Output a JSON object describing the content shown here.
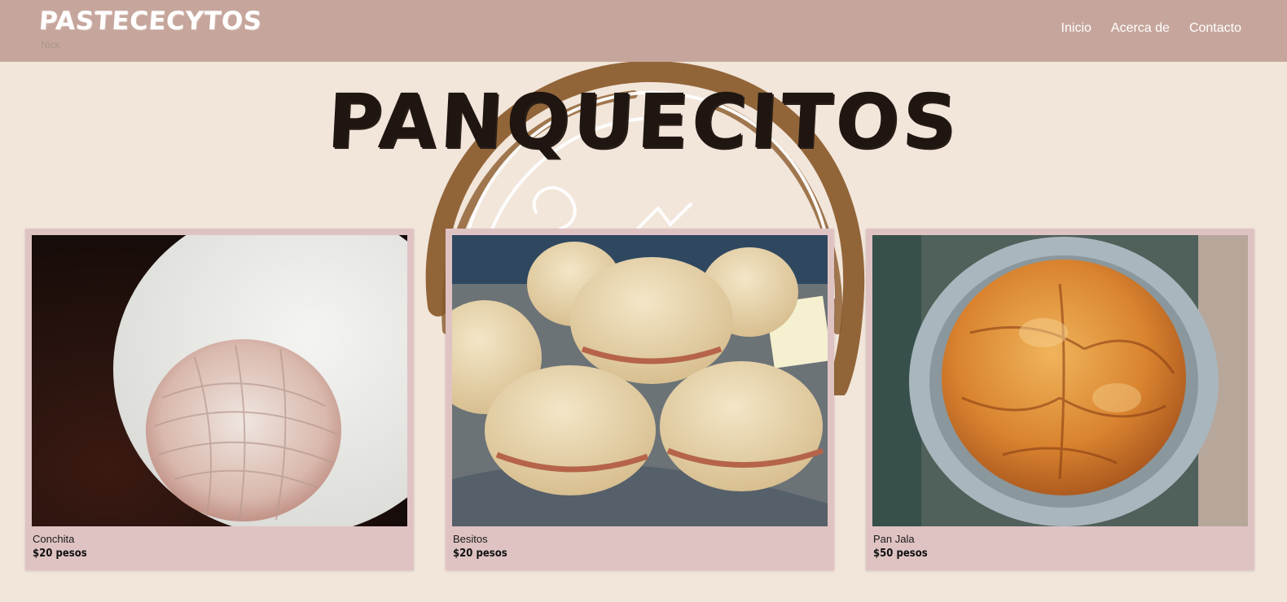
{
  "header": {
    "brand": "PASTECECYTOS",
    "brand_sub": "Nick",
    "nav": [
      {
        "label": "Inicio"
      },
      {
        "label": "Acerca de"
      },
      {
        "label": "Contacto"
      }
    ]
  },
  "page": {
    "title": "PANQUECITOS"
  },
  "products": [
    {
      "name": "Conchita",
      "price": "$20 pesos",
      "image": "conchita-bread"
    },
    {
      "name": "Besitos",
      "price": "$20 pesos",
      "image": "besitos-bread"
    },
    {
      "name": "Pan Jala",
      "price": "$50 pesos",
      "image": "pan-jala-bread"
    }
  ],
  "colors": {
    "header_bg": "#c6a69c",
    "page_bg": "#f2e6da",
    "card_bg": "#dfc3c3",
    "seal_brown": "#8a5a2b",
    "title": "#1f1612"
  }
}
